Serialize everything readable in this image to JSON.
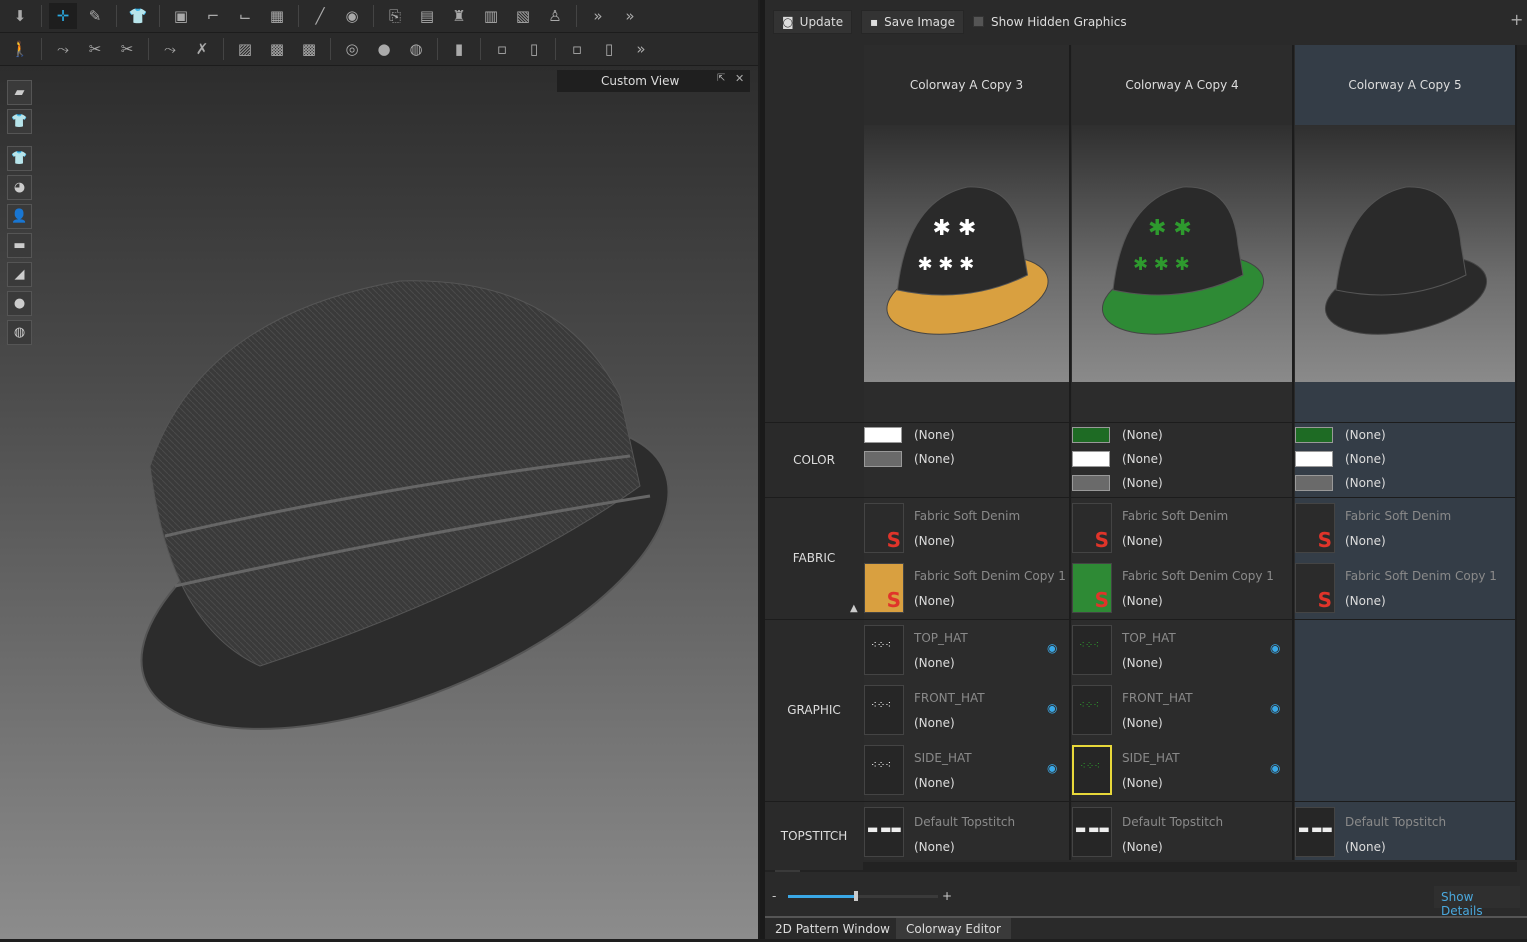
{
  "viewport": {
    "view_label": "Custom View"
  },
  "toolbar": {
    "update": "Update",
    "save_image": "Save Image",
    "show_hidden_graphics": "Show Hidden Graphics",
    "add": "+"
  },
  "rows": {
    "color": "COLOR",
    "fabric": "FABRIC",
    "graphic": "GRAPHIC",
    "topstitch": "TOPSTITCH"
  },
  "columns": [
    {
      "title": "Colorway A Copy 3",
      "selected": false,
      "hat_top": "#2a2a2a",
      "hat_brim": "#d9a040",
      "print": "#ffffff",
      "colors": [
        {
          "hex": "#ffffff",
          "value": "(None)"
        },
        {
          "hex": "#6a6a6a",
          "value": "(None)"
        }
      ],
      "fabrics": [
        {
          "name": "Fabric Soft Denim",
          "value": "(None)",
          "swatch": "#2b2b2b"
        },
        {
          "name": "Fabric Soft Denim Copy 1",
          "value": "(None)",
          "swatch": "#d9a040"
        }
      ],
      "graphics": [
        {
          "name": "TOP_HAT",
          "value": "(None)"
        },
        {
          "name": "FRONT_HAT",
          "value": "(None)"
        },
        {
          "name": "SIDE_HAT",
          "value": "(None)"
        }
      ],
      "topstitch": {
        "name": "Default Topstitch",
        "value": "(None)"
      }
    },
    {
      "title": "Colorway A Copy 4",
      "selected": false,
      "hat_top": "#2a2a2a",
      "hat_brim": "#2e8a35",
      "print": "#2e9a2e",
      "colors": [
        {
          "hex": "#1e6b24",
          "value": "(None)"
        },
        {
          "hex": "#ffffff",
          "value": "(None)"
        },
        {
          "hex": "#6a6a6a",
          "value": "(None)"
        }
      ],
      "fabrics": [
        {
          "name": "Fabric Soft Denim",
          "value": "(None)",
          "swatch": "#2b2b2b"
        },
        {
          "name": "Fabric Soft Denim Copy 1",
          "value": "(None)",
          "swatch": "#2e8a35"
        }
      ],
      "graphics": [
        {
          "name": "TOP_HAT",
          "value": "(None)"
        },
        {
          "name": "FRONT_HAT",
          "value": "(None)"
        },
        {
          "name": "SIDE_HAT",
          "value": "(None)",
          "highlighted": true
        }
      ],
      "topstitch": {
        "name": "Default Topstitch",
        "value": "(None)"
      }
    },
    {
      "title": "Colorway A Copy 5",
      "selected": true,
      "hat_top": "#2a2a2a",
      "hat_brim": "#2a2a2a",
      "print": "",
      "colors": [
        {
          "hex": "#1e6b24",
          "value": "(None)"
        },
        {
          "hex": "#ffffff",
          "value": "(None)"
        },
        {
          "hex": "#6a6a6a",
          "value": "(None)"
        }
      ],
      "fabrics": [
        {
          "name": "Fabric Soft Denim",
          "value": "(None)",
          "swatch": "#2b2b2b"
        },
        {
          "name": "Fabric Soft Denim Copy 1",
          "value": "(None)",
          "swatch": "#2b2b2b"
        }
      ],
      "graphics": [],
      "topstitch": {
        "name": "Default Topstitch",
        "value": "(None)"
      }
    }
  ],
  "zoom": {
    "minus": "-",
    "plus": "+",
    "level": 0.45
  },
  "show_details": "Show Details",
  "tabs": [
    {
      "label": "2D Pattern Window",
      "active": false
    },
    {
      "label": "Colorway Editor",
      "active": true
    }
  ],
  "accent": "#3aa8e6"
}
